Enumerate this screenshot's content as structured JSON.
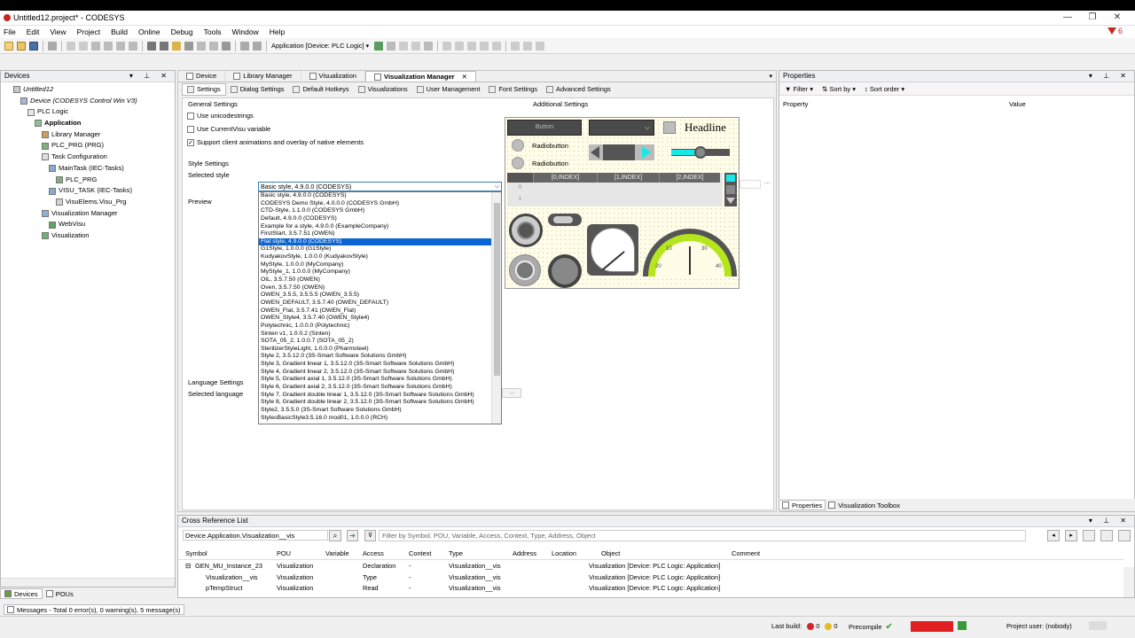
{
  "window": {
    "title": "Untitled12.project* - CODESYS",
    "min": "—",
    "max": "❐",
    "close": "✕"
  },
  "menu": [
    "File",
    "Edit",
    "View",
    "Project",
    "Build",
    "Online",
    "Debug",
    "Tools",
    "Window",
    "Help"
  ],
  "filter_indicator": "6",
  "toolbar": {
    "application": "Application [Device: PLC Logic]"
  },
  "devices": {
    "title": "Devices",
    "tree": [
      {
        "label": "Untitled12",
        "depth": 0,
        "style": "italic",
        "exp": "⊟"
      },
      {
        "label": "Device (CODESYS Control Win V3)",
        "depth": 1,
        "style": "italic",
        "exp": "⊟"
      },
      {
        "label": "PLC Logic",
        "depth": 2,
        "style": "",
        "exp": "⊟"
      },
      {
        "label": "Application",
        "depth": 3,
        "style": "bold",
        "exp": "⊟"
      },
      {
        "label": "Library Manager",
        "depth": 4,
        "style": "",
        "exp": ""
      },
      {
        "label": "PLC_PRG (PRG)",
        "depth": 4,
        "style": "",
        "exp": ""
      },
      {
        "label": "Task Configuration",
        "depth": 4,
        "style": "",
        "exp": "⊟"
      },
      {
        "label": "MainTask (IEC-Tasks)",
        "depth": 5,
        "style": "",
        "exp": "⊟"
      },
      {
        "label": "PLC_PRG",
        "depth": 6,
        "style": "",
        "exp": ""
      },
      {
        "label": "VISU_TASK (IEC-Tasks)",
        "depth": 5,
        "style": "",
        "exp": "⊟"
      },
      {
        "label": "VisuElems.Visu_Prg",
        "depth": 6,
        "style": "",
        "exp": ""
      },
      {
        "label": "Visualization Manager",
        "depth": 4,
        "style": "",
        "exp": "⊟"
      },
      {
        "label": "WebVisu",
        "depth": 5,
        "style": "",
        "exp": ""
      },
      {
        "label": "Visualization",
        "depth": 4,
        "style": "",
        "exp": ""
      }
    ],
    "tabs": [
      "Devices",
      "POUs"
    ]
  },
  "editor": {
    "tabs": [
      "Device",
      "Library Manager",
      "Visualization",
      "Visualization Manager"
    ],
    "subtabs": [
      "Settings",
      "Dialog Settings",
      "Default Hotkeys",
      "Visualizations",
      "User Management",
      "Font Settings",
      "Advanced Settings"
    ],
    "general_settings": "General Settings",
    "additional_settings": "Additional Settings",
    "options": [
      {
        "label": "Use unicodestrings",
        "checked": false
      },
      {
        "label": "Use CurrentVisu variable",
        "checked": false
      },
      {
        "label": "Support client animations and overlay of native elements",
        "checked": true
      }
    ],
    "style_settings": "Style Settings",
    "selected_style_label": "Selected style",
    "selected_style_value": "Basic style, 4.9.0.0 (CODESYS)",
    "preview_label": "Preview",
    "language_settings": "Language Settings",
    "selected_language_label": "Selected language",
    "style_options": [
      "Basic style, 4.9.0.0 (CODESYS)",
      "CODESYS Demo Style, 4.0.0.0 (CODESYS GmbH)",
      "CTD-Style, 1.1.0.0 (CODESYS GmbH)",
      "Default, 4.9.0.0 (CODESYS)",
      "Example for a style, 4.9.0.0 (ExampleCompany)",
      "FirstStart, 3.5.7.51 (OWEN)",
      "Flat style, 4.9.0.0 (CODESYS)",
      "G1Style, 1.0.0.0 (G1Style)",
      "KudyakovStyle, 1.0.0.0 (KudyakovStyle)",
      "MyStyle, 1.0.0.0 (MyCompany)",
      "MyStyle_1, 1.0.0.0 (MyCompany)",
      "OIL, 3.5.7.50 (OWEN)",
      "Oven, 3.5.7.50 (OWEN)",
      "OWEN_3.5.5, 3.5.5.5 (OWEN_3.5.5)",
      "OWEN_DEFAULT, 3.5.7.40 (OWEN_DEFAULT)",
      "OWEN_Flat, 3.5.7.41 (OWEN_Flat)",
      "OWEN_Style4, 3.5.7.40 (OWEN_Style4)",
      "Polytechnic, 1.0.0.0 (Polytechnic)",
      "Sinten v1, 1.0.0.2 (Sinten)",
      "SOTA_05_2, 1.0.0.7 (SOTA_05_2)",
      "SterilizerStyleLight, 1.0.0.0 (Pharmsteel)",
      "Style 2, 3.5.12.0 (3S-Smart Software Solutions GmbH)",
      "Style 3, Gradient linear 1, 3.5.12.0 (3S-Smart Software Solutions GmbH)",
      "Style 4, Gradient linear 2, 3.5.12.0 (3S-Smart Software Solutions GmbH)",
      "Style 5, Gradient axial 1, 3.5.12.0 (3S-Smart Software Solutions GmbH)",
      "Style 6, Gradient axial 2, 3.5.12.0 (3S-Smart Software Solutions GmbH)",
      "Style 7, Gradient double linear 1, 3.5.12.0 (3S-Smart Software Solutions GmbH)",
      "Style 8, Gradient double linear 2, 3.5.12.0 (3S-Smart Software Solutions GmbH)",
      "Style2, 3.5.5.0 (3S-Smart Software Solutions GmbH)",
      "StylesBasicStyle3.5.16.0 mod01, 1.0.0.0 (RCH)"
    ],
    "selected_index": 6,
    "preview": {
      "button": "Button",
      "headline": "Headline",
      "radio1": "Radiobutton",
      "radio2": "Radiobutton",
      "col0": "[0,INDEX]",
      "col1": "[1,INDEX]",
      "col2": "[2,INDEX]",
      "row0": "0",
      "row1": "1",
      "meter_labels": [
        "10",
        "20",
        "30",
        "40"
      ]
    }
  },
  "properties": {
    "title": "Properties",
    "filter": "Filter",
    "sort_by": "Sort by",
    "sort_order": "Sort order",
    "col_property": "Property",
    "col_value": "Value",
    "tabs": [
      "Properties",
      "Visualization Toolbox"
    ]
  },
  "crossref": {
    "title": "Cross Reference List",
    "scope": "Device.Application.Visualization__vis",
    "filter_placeholder": "Filter by Symbol, POU, Variable, Access, Context, Type, Address, Object",
    "columns": [
      "Symbol",
      "POU",
      "Variable",
      "Access",
      "Context",
      "Type",
      "Address",
      "Location",
      "Object",
      "Comment"
    ],
    "rows": [
      {
        "symbol": "GEN_MU_Instance_23",
        "pou": "Visualization",
        "access": "Declaration",
        "context": "-",
        "type": "Visualization__vis",
        "object": "Visualization [Device: PLC Logic: Application]"
      },
      {
        "symbol": "Visualization__vis",
        "pou": "Visualization",
        "access": "Type",
        "context": "-",
        "type": "Visualization__vis",
        "object": "Visualization [Device: PLC Logic: Application]"
      },
      {
        "symbol": "pTempStruct",
        "pou": "Visualization",
        "access": "Read",
        "context": "-",
        "type": "Visualization__vis",
        "object": "Visualization [Device: PLC Logic: Application]"
      }
    ]
  },
  "status": {
    "messages": "Messages - Total 0 error(s), 0 warning(s), 5 message(s)",
    "last_build": "Last build:",
    "errors": "0",
    "warnings": "0",
    "precompile": "Precompile",
    "user": "Project user: (nobody)"
  },
  "colors": {
    "accent": "#0a64d2",
    "codesys_red": "#c8261e",
    "preview_bg": "#fffde8",
    "slider_cyan": "#19e8e8",
    "meter_green": "#b5e61d"
  }
}
